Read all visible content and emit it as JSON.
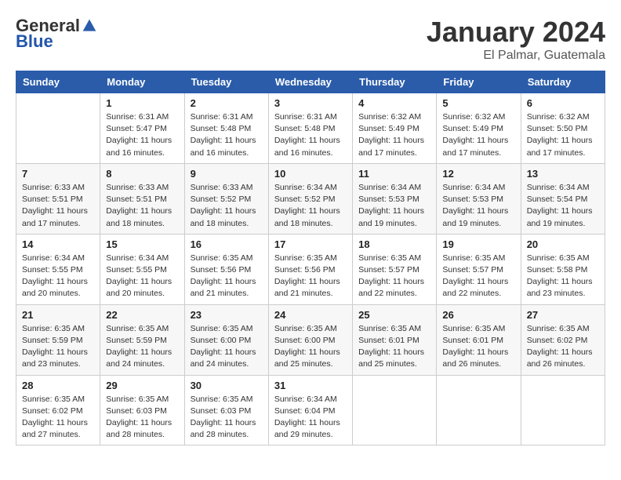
{
  "header": {
    "logo_general": "General",
    "logo_blue": "Blue",
    "month": "January 2024",
    "location": "El Palmar, Guatemala"
  },
  "days_of_week": [
    "Sunday",
    "Monday",
    "Tuesday",
    "Wednesday",
    "Thursday",
    "Friday",
    "Saturday"
  ],
  "weeks": [
    [
      {
        "day": "",
        "sunrise": "",
        "sunset": "",
        "daylight": ""
      },
      {
        "day": "1",
        "sunrise": "Sunrise: 6:31 AM",
        "sunset": "Sunset: 5:47 PM",
        "daylight": "Daylight: 11 hours and 16 minutes."
      },
      {
        "day": "2",
        "sunrise": "Sunrise: 6:31 AM",
        "sunset": "Sunset: 5:48 PM",
        "daylight": "Daylight: 11 hours and 16 minutes."
      },
      {
        "day": "3",
        "sunrise": "Sunrise: 6:31 AM",
        "sunset": "Sunset: 5:48 PM",
        "daylight": "Daylight: 11 hours and 16 minutes."
      },
      {
        "day": "4",
        "sunrise": "Sunrise: 6:32 AM",
        "sunset": "Sunset: 5:49 PM",
        "daylight": "Daylight: 11 hours and 17 minutes."
      },
      {
        "day": "5",
        "sunrise": "Sunrise: 6:32 AM",
        "sunset": "Sunset: 5:49 PM",
        "daylight": "Daylight: 11 hours and 17 minutes."
      },
      {
        "day": "6",
        "sunrise": "Sunrise: 6:32 AM",
        "sunset": "Sunset: 5:50 PM",
        "daylight": "Daylight: 11 hours and 17 minutes."
      }
    ],
    [
      {
        "day": "7",
        "sunrise": "Sunrise: 6:33 AM",
        "sunset": "Sunset: 5:51 PM",
        "daylight": "Daylight: 11 hours and 17 minutes."
      },
      {
        "day": "8",
        "sunrise": "Sunrise: 6:33 AM",
        "sunset": "Sunset: 5:51 PM",
        "daylight": "Daylight: 11 hours and 18 minutes."
      },
      {
        "day": "9",
        "sunrise": "Sunrise: 6:33 AM",
        "sunset": "Sunset: 5:52 PM",
        "daylight": "Daylight: 11 hours and 18 minutes."
      },
      {
        "day": "10",
        "sunrise": "Sunrise: 6:34 AM",
        "sunset": "Sunset: 5:52 PM",
        "daylight": "Daylight: 11 hours and 18 minutes."
      },
      {
        "day": "11",
        "sunrise": "Sunrise: 6:34 AM",
        "sunset": "Sunset: 5:53 PM",
        "daylight": "Daylight: 11 hours and 19 minutes."
      },
      {
        "day": "12",
        "sunrise": "Sunrise: 6:34 AM",
        "sunset": "Sunset: 5:53 PM",
        "daylight": "Daylight: 11 hours and 19 minutes."
      },
      {
        "day": "13",
        "sunrise": "Sunrise: 6:34 AM",
        "sunset": "Sunset: 5:54 PM",
        "daylight": "Daylight: 11 hours and 19 minutes."
      }
    ],
    [
      {
        "day": "14",
        "sunrise": "Sunrise: 6:34 AM",
        "sunset": "Sunset: 5:55 PM",
        "daylight": "Daylight: 11 hours and 20 minutes."
      },
      {
        "day": "15",
        "sunrise": "Sunrise: 6:34 AM",
        "sunset": "Sunset: 5:55 PM",
        "daylight": "Daylight: 11 hours and 20 minutes."
      },
      {
        "day": "16",
        "sunrise": "Sunrise: 6:35 AM",
        "sunset": "Sunset: 5:56 PM",
        "daylight": "Daylight: 11 hours and 21 minutes."
      },
      {
        "day": "17",
        "sunrise": "Sunrise: 6:35 AM",
        "sunset": "Sunset: 5:56 PM",
        "daylight": "Daylight: 11 hours and 21 minutes."
      },
      {
        "day": "18",
        "sunrise": "Sunrise: 6:35 AM",
        "sunset": "Sunset: 5:57 PM",
        "daylight": "Daylight: 11 hours and 22 minutes."
      },
      {
        "day": "19",
        "sunrise": "Sunrise: 6:35 AM",
        "sunset": "Sunset: 5:57 PM",
        "daylight": "Daylight: 11 hours and 22 minutes."
      },
      {
        "day": "20",
        "sunrise": "Sunrise: 6:35 AM",
        "sunset": "Sunset: 5:58 PM",
        "daylight": "Daylight: 11 hours and 23 minutes."
      }
    ],
    [
      {
        "day": "21",
        "sunrise": "Sunrise: 6:35 AM",
        "sunset": "Sunset: 5:59 PM",
        "daylight": "Daylight: 11 hours and 23 minutes."
      },
      {
        "day": "22",
        "sunrise": "Sunrise: 6:35 AM",
        "sunset": "Sunset: 5:59 PM",
        "daylight": "Daylight: 11 hours and 24 minutes."
      },
      {
        "day": "23",
        "sunrise": "Sunrise: 6:35 AM",
        "sunset": "Sunset: 6:00 PM",
        "daylight": "Daylight: 11 hours and 24 minutes."
      },
      {
        "day": "24",
        "sunrise": "Sunrise: 6:35 AM",
        "sunset": "Sunset: 6:00 PM",
        "daylight": "Daylight: 11 hours and 25 minutes."
      },
      {
        "day": "25",
        "sunrise": "Sunrise: 6:35 AM",
        "sunset": "Sunset: 6:01 PM",
        "daylight": "Daylight: 11 hours and 25 minutes."
      },
      {
        "day": "26",
        "sunrise": "Sunrise: 6:35 AM",
        "sunset": "Sunset: 6:01 PM",
        "daylight": "Daylight: 11 hours and 26 minutes."
      },
      {
        "day": "27",
        "sunrise": "Sunrise: 6:35 AM",
        "sunset": "Sunset: 6:02 PM",
        "daylight": "Daylight: 11 hours and 26 minutes."
      }
    ],
    [
      {
        "day": "28",
        "sunrise": "Sunrise: 6:35 AM",
        "sunset": "Sunset: 6:02 PM",
        "daylight": "Daylight: 11 hours and 27 minutes."
      },
      {
        "day": "29",
        "sunrise": "Sunrise: 6:35 AM",
        "sunset": "Sunset: 6:03 PM",
        "daylight": "Daylight: 11 hours and 28 minutes."
      },
      {
        "day": "30",
        "sunrise": "Sunrise: 6:35 AM",
        "sunset": "Sunset: 6:03 PM",
        "daylight": "Daylight: 11 hours and 28 minutes."
      },
      {
        "day": "31",
        "sunrise": "Sunrise: 6:34 AM",
        "sunset": "Sunset: 6:04 PM",
        "daylight": "Daylight: 11 hours and 29 minutes."
      },
      {
        "day": "",
        "sunrise": "",
        "sunset": "",
        "daylight": ""
      },
      {
        "day": "",
        "sunrise": "",
        "sunset": "",
        "daylight": ""
      },
      {
        "day": "",
        "sunrise": "",
        "sunset": "",
        "daylight": ""
      }
    ]
  ]
}
